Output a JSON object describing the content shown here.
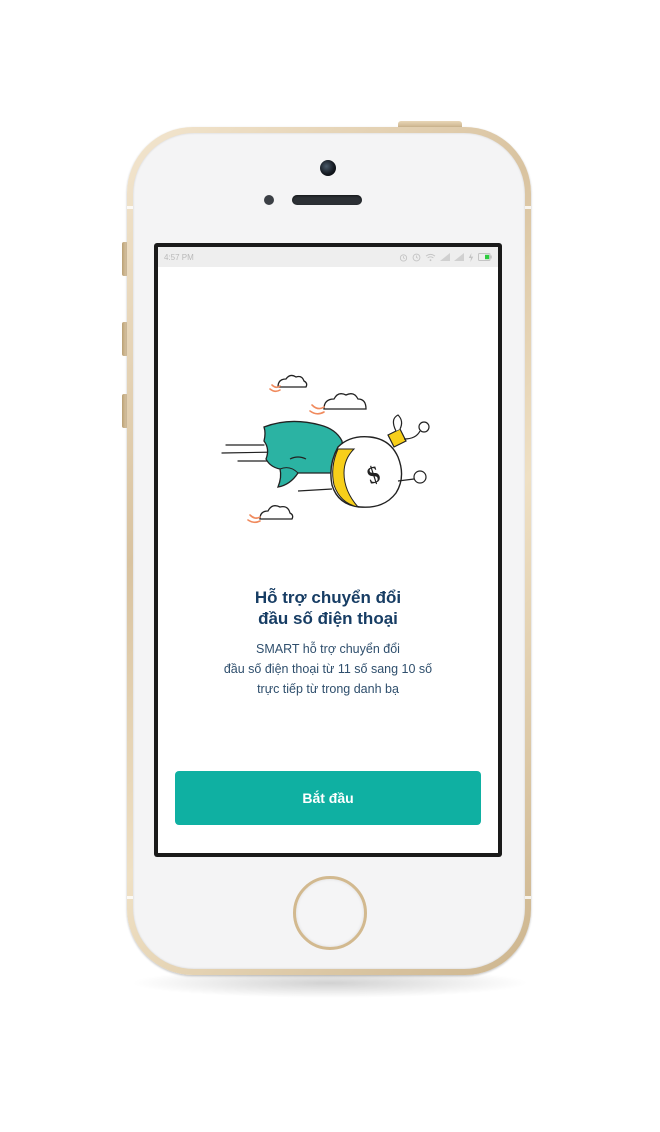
{
  "status_bar": {
    "time": "4:57 PM"
  },
  "onboarding": {
    "illustration": "flying-money-bag-with-cape",
    "title_line1": "Hỗ trợ chuyển đổi",
    "title_line2": "đầu số điện thoại",
    "description_line1": "SMART hỗ trợ chuyển đổi",
    "description_line2": "đầu số điện thoại từ 11 số sang 10 số",
    "description_line3": "trực tiếp từ trong danh bạ",
    "start_button": "Bắt đầu"
  },
  "colors": {
    "accent": "#0fb0a2",
    "title": "#173d64",
    "cape": "#2bb3a3",
    "bag_highlight": "#f7cf1a",
    "cloud_accent": "#f08a5d",
    "phone_gold": "#d9c3a0"
  }
}
